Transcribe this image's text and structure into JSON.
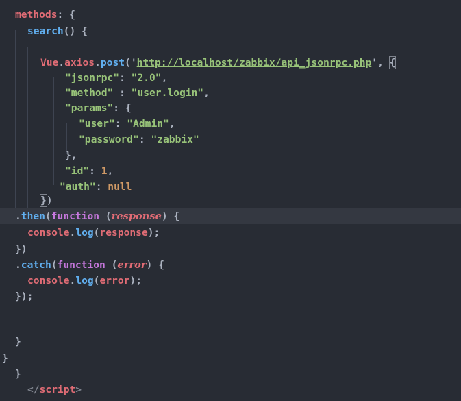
{
  "editor": {
    "colors": {
      "background": "#282c34",
      "active_line": "#343841",
      "key": "#e06c75",
      "function": "#61afef",
      "keyword": "#c678dd",
      "string": "#98c379",
      "number": "#d19a66",
      "punctuation": "#abb2bf"
    },
    "active_line_number": 14,
    "lines": [
      {
        "tokens": [
          {
            "t": "methods",
            "c": "key"
          },
          {
            "t": ": {",
            "c": "pun"
          }
        ]
      },
      {
        "tokens": [
          {
            "t": "search",
            "c": "fn"
          },
          {
            "t": "() {",
            "c": "pun"
          }
        ]
      },
      {
        "tokens": []
      },
      {
        "tokens": [
          {
            "t": "Vue",
            "c": "key"
          },
          {
            "t": ".",
            "c": "pun"
          },
          {
            "t": "axios",
            "c": "key"
          },
          {
            "t": ".",
            "c": "pun"
          },
          {
            "t": "post",
            "c": "fn"
          },
          {
            "t": "('",
            "c": "pun"
          },
          {
            "t": "http://localhost/zabbix/api_jsonrpc.php",
            "c": "url"
          },
          {
            "t": "', ",
            "c": "pun"
          },
          {
            "t": "{",
            "c": "brk"
          }
        ]
      },
      {
        "tokens": [
          {
            "t": "\"jsonrpc\"",
            "c": "str"
          },
          {
            "t": ": ",
            "c": "pun"
          },
          {
            "t": "\"2.0\"",
            "c": "str"
          },
          {
            "t": ",",
            "c": "pun"
          }
        ]
      },
      {
        "tokens": [
          {
            "t": "\"method\"",
            "c": "str"
          },
          {
            "t": " : ",
            "c": "pun"
          },
          {
            "t": "\"user.login\"",
            "c": "str"
          },
          {
            "t": ",",
            "c": "pun"
          }
        ]
      },
      {
        "tokens": [
          {
            "t": "\"params\"",
            "c": "str"
          },
          {
            "t": ": {",
            "c": "pun"
          }
        ]
      },
      {
        "tokens": [
          {
            "t": "\"user\"",
            "c": "str"
          },
          {
            "t": ": ",
            "c": "pun"
          },
          {
            "t": "\"Admin\"",
            "c": "str"
          },
          {
            "t": ",",
            "c": "pun"
          }
        ]
      },
      {
        "tokens": [
          {
            "t": "\"password\"",
            "c": "str"
          },
          {
            "t": ": ",
            "c": "pun"
          },
          {
            "t": "\"zabbix\"",
            "c": "str"
          }
        ]
      },
      {
        "tokens": [
          {
            "t": "},",
            "c": "pun"
          }
        ]
      },
      {
        "tokens": [
          {
            "t": "\"id\"",
            "c": "str"
          },
          {
            "t": ": ",
            "c": "pun"
          },
          {
            "t": "1",
            "c": "num"
          },
          {
            "t": ",",
            "c": "pun"
          }
        ]
      },
      {
        "tokens": [
          {
            "t": "\"auth\"",
            "c": "str"
          },
          {
            "t": ": ",
            "c": "pun"
          },
          {
            "t": "null",
            "c": "num"
          }
        ]
      },
      {
        "tokens": [
          {
            "t": "}",
            "c": "brk"
          },
          {
            "t": ")",
            "c": "pun"
          }
        ]
      },
      {
        "tokens": [
          {
            "t": ".",
            "c": "pun"
          },
          {
            "t": "then",
            "c": "fn"
          },
          {
            "t": "(",
            "c": "pun"
          },
          {
            "t": "function",
            "c": "kw"
          },
          {
            "t": " (",
            "c": "pun"
          },
          {
            "t": "response",
            "c": "prm"
          },
          {
            "t": ") {",
            "c": "pun"
          }
        ]
      },
      {
        "tokens": [
          {
            "t": "console",
            "c": "key"
          },
          {
            "t": ".",
            "c": "pun"
          },
          {
            "t": "log",
            "c": "fn"
          },
          {
            "t": "(",
            "c": "pun"
          },
          {
            "t": "response",
            "c": "key"
          },
          {
            "t": ");",
            "c": "pun"
          }
        ]
      },
      {
        "tokens": [
          {
            "t": "})",
            "c": "pun"
          }
        ]
      },
      {
        "tokens": [
          {
            "t": ".",
            "c": "pun"
          },
          {
            "t": "catch",
            "c": "fn"
          },
          {
            "t": "(",
            "c": "pun"
          },
          {
            "t": "function",
            "c": "kw"
          },
          {
            "t": " (",
            "c": "pun"
          },
          {
            "t": "error",
            "c": "prm"
          },
          {
            "t": ") {",
            "c": "pun"
          }
        ]
      },
      {
        "tokens": [
          {
            "t": "console",
            "c": "key"
          },
          {
            "t": ".",
            "c": "pun"
          },
          {
            "t": "log",
            "c": "fn"
          },
          {
            "t": "(",
            "c": "pun"
          },
          {
            "t": "error",
            "c": "key"
          },
          {
            "t": ");",
            "c": "pun"
          }
        ]
      },
      {
        "tokens": [
          {
            "t": "});",
            "c": "pun"
          }
        ]
      },
      {
        "tokens": []
      },
      {
        "tokens": []
      },
      {
        "tokens": [
          {
            "t": "}",
            "c": "pun"
          }
        ]
      },
      {
        "tokens": [
          {
            "t": "}",
            "c": "pun"
          }
        ]
      },
      {
        "tokens": [
          {
            "t": "}",
            "c": "pun"
          }
        ]
      },
      {
        "tokens": [
          {
            "t": "</",
            "c": "tagp"
          },
          {
            "t": "script",
            "c": "tag"
          },
          {
            "t": ">",
            "c": "tagp"
          }
        ]
      }
    ]
  }
}
